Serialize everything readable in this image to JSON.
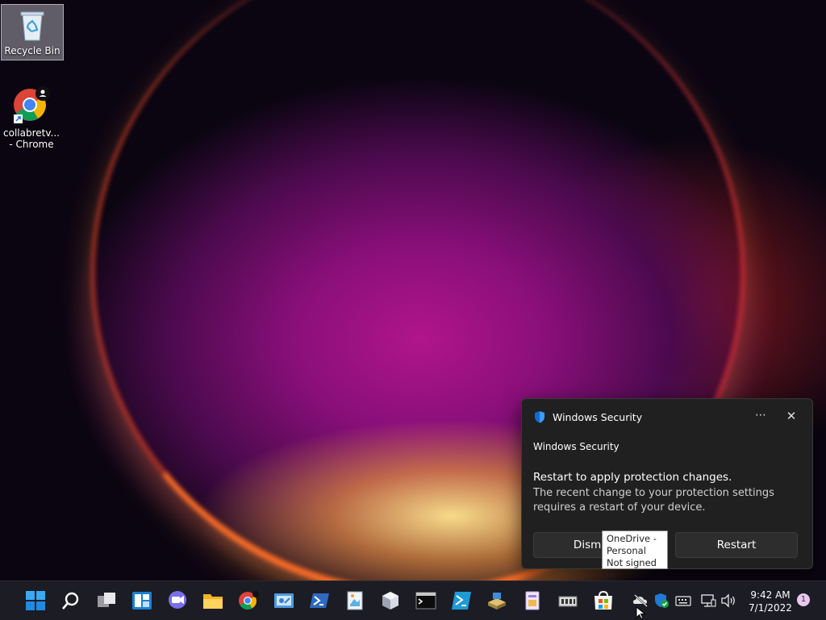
{
  "desktop": {
    "icons": [
      {
        "label": "Recycle Bin",
        "icon": "recycle-bin-icon"
      },
      {
        "label": "collabretv... - Chrome",
        "icon": "chrome-icon"
      }
    ]
  },
  "toast": {
    "app_name": "Windows Security",
    "source": "Windows Security",
    "title": "Restart to apply protection changes.",
    "body": "The recent change to your protection settings requires a restart of your device.",
    "more_glyph": "⋯",
    "close_glyph": "✕",
    "dismiss_label": "Dismiss",
    "restart_label": "Restart"
  },
  "tooltip": {
    "line1": "OneDrive -",
    "line2": "Personal",
    "line3": "Not signed in"
  },
  "taskbar": {
    "icons": [
      "start-icon",
      "search-icon",
      "task-view-icon",
      "widgets-icon",
      "chat-icon",
      "file-explorer-icon",
      "chrome-icon",
      "control-panel-icon",
      "powershell-icon",
      "paint-icon",
      "3d-viewer-icon",
      "terminal-icon",
      "azure-powershell-icon",
      "disk-icon",
      "notepad-icon",
      "device-manager-icon",
      "store-icon"
    ],
    "tray_icons": [
      "onedrive-icon",
      "windows-security-icon",
      "keyboard-icon",
      "network-icon",
      "volume-icon"
    ],
    "time": "9:42 AM",
    "date": "7/1/2022",
    "notification_count": "1"
  },
  "colors": {
    "accent": "#0078d4",
    "toast_bg": "#202020",
    "taskbar_bg": "#1c1c24"
  }
}
